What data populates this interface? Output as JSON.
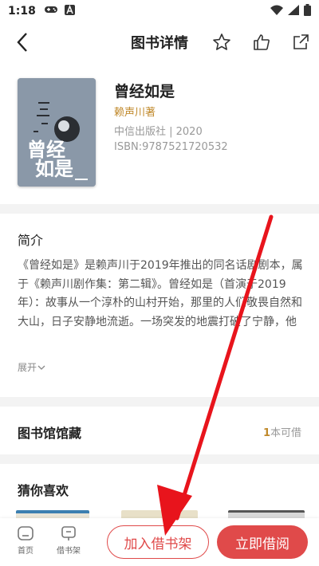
{
  "status": {
    "time": "1:18"
  },
  "nav": {
    "title": "图书详情"
  },
  "book": {
    "title": "曾经如是",
    "author": "赖声川著",
    "publisher": "中信出版社 | 2020",
    "isbn": "ISBN:9787521720532",
    "cover_title_1": "曾经",
    "cover_title_2": "如是"
  },
  "intro": {
    "heading": "简介",
    "text": "《曾经如是》是赖声川于2019年推出的同名话剧剧本，属于《赖声川剧作集：第二辑》。曾经如是（首演于2019年）：故事从一个淳朴的山村开始，那里的人们敬畏自然和大山，日子安静地流逝。一场突发的地震打破了宁静，他们前往纽约，却遭遇…",
    "expand_label": "展开"
  },
  "library": {
    "heading": "图书馆馆藏",
    "count": "1",
    "count_suffix": "本可借"
  },
  "guess": {
    "heading": "猜你喜欢"
  },
  "bottom": {
    "tab_home": "首页",
    "tab_shelf": "借书架",
    "add_shelf": "加入借书架",
    "borrow_now": "立即借阅"
  },
  "colors": {
    "accent": "#e04a4a",
    "author": "#c0892b"
  }
}
